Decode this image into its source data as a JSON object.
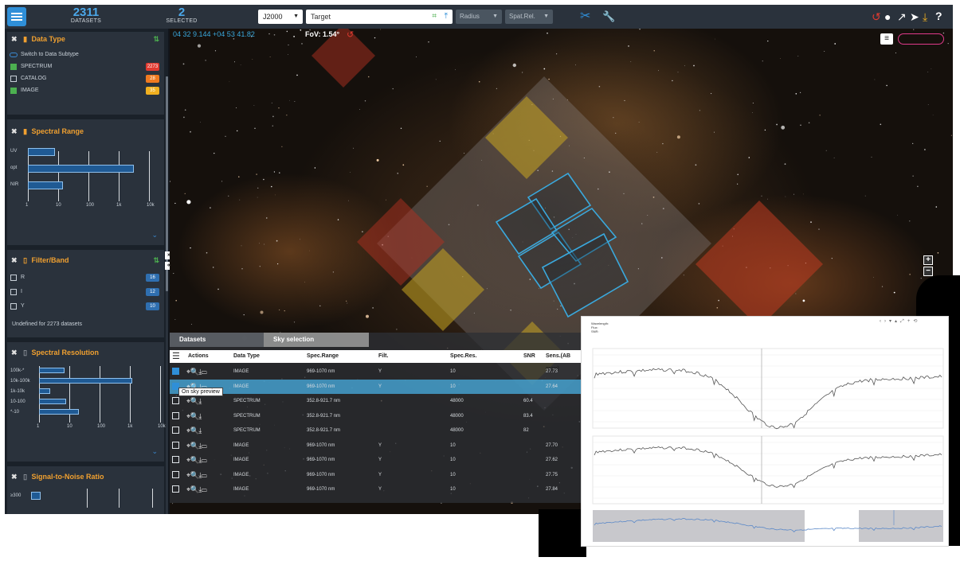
{
  "topbar": {
    "datasets_count": "2311",
    "datasets_label": "DATASETS",
    "selected_count": "2",
    "selected_label": "SELECTED",
    "coord_frame": "J2000",
    "target_placeholder": "Target",
    "radius_label": "Radius",
    "spatial_relation_label": "Spat.Rel.",
    "icons": [
      "hamburger-icon",
      "scissors-icon",
      "wrench-icon",
      "undo-icon",
      "lightbulb-icon",
      "share-icon",
      "rocket-icon",
      "download-icon",
      "help-icon"
    ]
  },
  "sky": {
    "coords": "04 32 9.144 +04 53 41.82",
    "fov": "FoV: 1.54°",
    "zoom_in": "+",
    "zoom_out": "−",
    "accent": "#3aa8dc"
  },
  "data_type": {
    "title": "Data Type",
    "switch_label": "Switch to Data Subtype",
    "items": [
      {
        "label": "SPECTRUM",
        "count": "2273",
        "checked": true,
        "color": "#e03a30"
      },
      {
        "label": "CATALOG",
        "count": "28",
        "checked": false,
        "color": "#f07a20"
      },
      {
        "label": "IMAGE",
        "count": "35",
        "checked": true,
        "color": "#f0b020"
      }
    ]
  },
  "spectral_range": {
    "title": "Spectral Range",
    "bands": [
      "UV",
      "opt",
      "NIR"
    ],
    "ticks": [
      "1",
      "10",
      "100",
      "1k",
      "10k"
    ]
  },
  "filter_band": {
    "title": "Filter/Band",
    "items": [
      {
        "label": "R",
        "count": "16"
      },
      {
        "label": "I",
        "count": "12"
      },
      {
        "label": "Y",
        "count": "10"
      }
    ],
    "undefined_note": "Undefined for 2273 datasets"
  },
  "spectral_resolution": {
    "title": "Spectral Resolution",
    "bands": [
      "100k-*",
      "10k-100k",
      "1k-10k",
      "10-100",
      "*-10"
    ],
    "ticks": [
      "1",
      "10",
      "100",
      "1k",
      "10k"
    ]
  },
  "snr_card": {
    "title": "Signal-to-Noise Ratio",
    "first_band": "≥300"
  },
  "datasets_table": {
    "tab_datasets": "Datasets",
    "tab_sky": "Sky selection",
    "headers": [
      "Actions",
      "Data Type",
      "Spec.Range",
      "Filt.",
      "Spec.Res.",
      "SNR",
      "Sens.(AB mag)"
    ],
    "tooltip": "On sky preview",
    "rows": [
      {
        "checked": true,
        "type": "IMAGE",
        "range": "969-1070 nm",
        "filt": "Y",
        "res": "10",
        "snr": "",
        "sens": "27.73",
        "highlight": false,
        "acts": "⌖🔍⤓▭"
      },
      {
        "checked": true,
        "type": "IMAGE",
        "range": "969-1070 nm",
        "filt": "Y",
        "res": "10",
        "snr": "",
        "sens": "27.64",
        "highlight": true,
        "acts": "⌖🔍⤓▭"
      },
      {
        "checked": false,
        "type": "SPECTRUM",
        "range": "352.8-921.7 nm",
        "filt": "",
        "res": "48000",
        "snr": "60.4",
        "sens": "",
        "highlight": false,
        "acts": "⌖🔍⤓"
      },
      {
        "checked": false,
        "type": "SPECTRUM",
        "range": "352.8-921.7 nm",
        "filt": "",
        "res": "48000",
        "snr": "83.4",
        "sens": "",
        "highlight": false,
        "acts": "⌖🔍⤓"
      },
      {
        "checked": false,
        "type": "SPECTRUM",
        "range": "352.8-921.7 nm",
        "filt": "",
        "res": "48000",
        "snr": "82",
        "sens": "",
        "highlight": false,
        "acts": "⌖🔍⤓"
      },
      {
        "checked": false,
        "type": "IMAGE",
        "range": "969-1070 nm",
        "filt": "Y",
        "res": "10",
        "snr": "",
        "sens": "27.70",
        "highlight": false,
        "acts": "⌖🔍⤓▭"
      },
      {
        "checked": false,
        "type": "IMAGE",
        "range": "969-1070 nm",
        "filt": "Y",
        "res": "10",
        "snr": "",
        "sens": "27.62",
        "highlight": false,
        "acts": "⌖🔍⤓▭"
      },
      {
        "checked": false,
        "type": "IMAGE",
        "range": "969-1070 nm",
        "filt": "Y",
        "res": "10",
        "snr": "",
        "sens": "27.75",
        "highlight": false,
        "acts": "⌖🔍⤓▭"
      },
      {
        "checked": false,
        "type": "IMAGE",
        "range": "969-1070 nm",
        "filt": "Y",
        "res": "10",
        "snr": "",
        "sens": "27.84",
        "highlight": false,
        "acts": "⌖🔍⤓▭"
      }
    ]
  },
  "spectrum_preview": {
    "meta": [
      "Wavelength:",
      "Flux:",
      "SNR:"
    ]
  }
}
